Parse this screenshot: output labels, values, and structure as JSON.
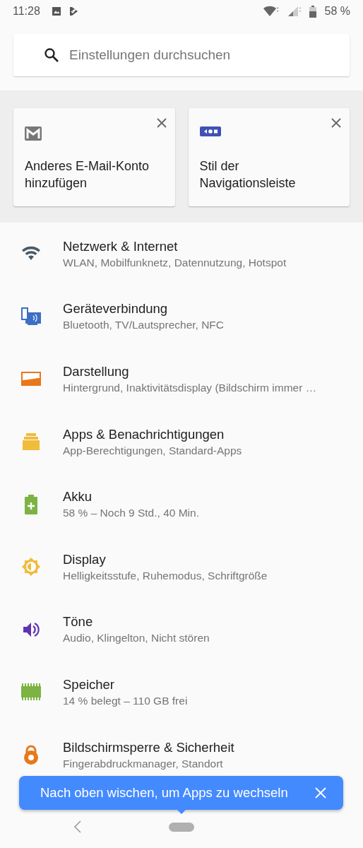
{
  "status_bar": {
    "time": "11:28",
    "battery": "58 %"
  },
  "search": {
    "placeholder": "Einstellungen durchsuchen"
  },
  "suggestions": [
    {
      "title": "Anderes E-Mail-Konto hinzufügen"
    },
    {
      "title": "Stil der Navigationsleiste"
    }
  ],
  "settings": [
    {
      "title": "Netzwerk & Internet",
      "summary": "WLAN, Mobilfunknetz, Datennutzung, Hotspot"
    },
    {
      "title": "Geräteverbindung",
      "summary": "Bluetooth, TV/Lautsprecher, NFC"
    },
    {
      "title": "Darstellung",
      "summary": "Hintergrund, Inaktivitätsdisplay (Bildschirm immer …"
    },
    {
      "title": "Apps & Benachrichtigungen",
      "summary": "App-Berechtigungen, Standard-Apps"
    },
    {
      "title": "Akku",
      "summary": "58 % – Noch 9 Std.,  40 Min."
    },
    {
      "title": "Display",
      "summary": "Helligkeitsstufe, Ruhemodus, Schriftgröße"
    },
    {
      "title": "Töne",
      "summary": "Audio, Klingelton, Nicht stören"
    },
    {
      "title": "Speicher",
      "summary": "14 % belegt – 110 GB frei"
    },
    {
      "title": "Bildschirmsperre & Sicherheit",
      "summary": "Fingerabdruckmanager, Standort"
    }
  ],
  "toast": {
    "text": "Nach oben wischen, um Apps zu wechseln"
  }
}
